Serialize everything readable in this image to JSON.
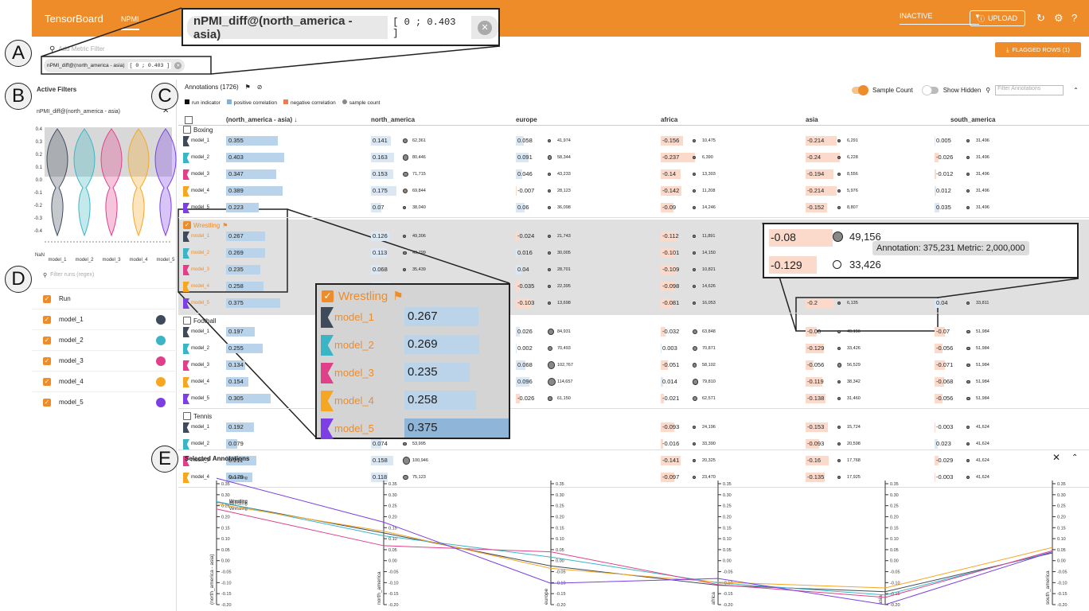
{
  "topbar": {
    "brand": "TensorBoard",
    "tab": "NPMI",
    "mode": "INACTIVE",
    "upload": "UPLOAD"
  },
  "flagged": "FLAGGED ROWS (1)",
  "filter": {
    "placeholder": "Add Metric Filter",
    "chip_metric": "nPMI_diff@(north_america - asia)",
    "chip_range": "[ 0 ; 0.403 ]"
  },
  "left": {
    "active_filters": "Active Filters",
    "filter_name": "nPMI_diff@(north_america - asia)",
    "yticks": [
      "0.4",
      "0.3",
      "0.2",
      "0.1",
      "0.0",
      "-0.1",
      "-0.2",
      "-0.3",
      "-0.4"
    ],
    "nan": "NaN",
    "xlabels": [
      "model_1",
      "model_2",
      "model_3",
      "model_4",
      "model_5"
    ],
    "search_placeholder": "Filter runs (regex)",
    "runs_header": "Run",
    "runs": [
      {
        "name": "model_1",
        "color": "#3f4a5a"
      },
      {
        "name": "model_2",
        "color": "#3bb5c5"
      },
      {
        "name": "model_3",
        "color": "#e0408a"
      },
      {
        "name": "model_4",
        "color": "#f5a623"
      },
      {
        "name": "model_5",
        "color": "#7b3fe4"
      }
    ]
  },
  "annotations": {
    "title": "Annotations (1726)",
    "legend": [
      "run indicator",
      "positive correlation",
      "negative correlation",
      "sample count"
    ],
    "sample_count": "Sample Count",
    "show_hidden": "Show Hidden",
    "filter_placeholder": "Filter Annotations",
    "columns": [
      "(north_america - asia) ↓",
      "north_america",
      "europe",
      "africa",
      "asia",
      "south_america"
    ]
  },
  "groups": [
    {
      "name": "Boxing",
      "rows": [
        {
          "m": "model_1",
          "d": "0.355",
          "v": [
            [
              "0.141",
              "62,361"
            ],
            [
              "0.058",
              "41,974"
            ],
            [
              "-0.156",
              "10,475"
            ],
            [
              "-0.214",
              "6,291"
            ],
            [
              "0.005",
              "31,496"
            ]
          ]
        },
        {
          "m": "model_2",
          "d": "0.403",
          "v": [
            [
              "0.163",
              "80,446"
            ],
            [
              "0.091",
              "58,344"
            ],
            [
              "-0.237",
              "6,390"
            ],
            [
              "-0.24",
              "6,228"
            ],
            [
              "-0.026",
              "31,496"
            ]
          ]
        },
        {
          "m": "model_3",
          "d": "0.347",
          "v": [
            [
              "0.153",
              "71,715"
            ],
            [
              "0.046",
              "43,233"
            ],
            [
              "-0.14",
              "13,303"
            ],
            [
              "-0.194",
              "8,556"
            ],
            [
              "-0.012",
              "31,496"
            ]
          ]
        },
        {
          "m": "model_4",
          "d": "0.389",
          "v": [
            [
              "0.175",
              "69,844"
            ],
            [
              "-0.007",
              "28,123"
            ],
            [
              "-0.142",
              "11,208"
            ],
            [
              "-0.214",
              "5,976"
            ],
            [
              "0.012",
              "31,496"
            ]
          ]
        },
        {
          "m": "model_5",
          "d": "0.223",
          "v": [
            [
              "0.07",
              "38,040"
            ],
            [
              "0.06",
              "36,098"
            ],
            [
              "-0.09",
              "14,246"
            ],
            [
              "-0.152",
              "8,807"
            ],
            [
              "0.035",
              "31,496"
            ]
          ]
        }
      ]
    },
    {
      "name": "Wrestling",
      "rows": [
        {
          "m": "model_1",
          "d": "0.267",
          "v": [
            [
              "0.126",
              "49,306"
            ],
            [
              "-0.024",
              "21,743"
            ],
            [
              "-0.112",
              "11,891"
            ],
            [
              "",
              ""
            ],
            [
              "",
              ""
            ]
          ]
        },
        {
          "m": "model_2",
          "d": "0.269",
          "v": [
            [
              "0.113",
              "49,799"
            ],
            [
              "0.016",
              "30,005"
            ],
            [
              "-0.101",
              "14,150"
            ],
            [
              "",
              ""
            ],
            [
              "",
              ""
            ]
          ]
        },
        {
          "m": "model_3",
          "d": "0.235",
          "v": [
            [
              "0.068",
              "35,439"
            ],
            [
              "0.04",
              "28,701"
            ],
            [
              "-0.109",
              "10,821"
            ],
            [
              "",
              ""
            ],
            [
              "",
              ""
            ]
          ]
        },
        {
          "m": "model_4",
          "d": "0.258",
          "v": [
            [
              "0.134",
              "55,716"
            ],
            [
              "-0.035",
              "22,395"
            ],
            [
              "-0.098",
              "14,626"
            ],
            [
              "",
              ""
            ],
            [
              "",
              ""
            ]
          ]
        },
        {
          "m": "model_5",
          "d": "0.375",
          "v": [
            [
              "0.175",
              "65,084"
            ],
            [
              "-0.103",
              "13,698"
            ],
            [
              "-0.081",
              "16,053"
            ],
            [
              "-0.2",
              "6,135"
            ],
            [
              "0.04",
              "33,811"
            ]
          ]
        }
      ]
    },
    {
      "name": "Football",
      "rows": [
        {
          "m": "model_1",
          "d": "0.197",
          "v": [
            [
              "",
              ""
            ],
            [
              "0.026",
              "84,931"
            ],
            [
              "-0.032",
              "63,848"
            ],
            [
              "-0.08",
              "49,156"
            ],
            [
              "-0.07",
              "51,984"
            ]
          ]
        },
        {
          "m": "model_2",
          "d": "0.255",
          "v": [
            [
              "",
              ""
            ],
            [
              "0.002",
              "70,493"
            ],
            [
              "0.003",
              "70,871"
            ],
            [
              "-0.129",
              "33,426"
            ],
            [
              "-0.056",
              "51,984"
            ]
          ]
        },
        {
          "m": "model_3",
          "d": "0.134",
          "v": [
            [
              "",
              ""
            ],
            [
              "0.068",
              "102,767"
            ],
            [
              "-0.051",
              "58,102"
            ],
            [
              "-0.056",
              "56,529"
            ],
            [
              "-0.071",
              "51,984"
            ]
          ]
        },
        {
          "m": "model_4",
          "d": "0.154",
          "v": [
            [
              "",
              ""
            ],
            [
              "0.096",
              "114,657"
            ],
            [
              "0.014",
              "79,810"
            ],
            [
              "-0.119",
              "38,342"
            ],
            [
              "-0.068",
              "51,984"
            ]
          ]
        },
        {
          "m": "model_5",
          "d": "0.305",
          "v": [
            [
              "",
              ""
            ],
            [
              "-0.026",
              "61,150"
            ],
            [
              "-0.021",
              "62,571"
            ],
            [
              "-0.138",
              "31,460"
            ],
            [
              "-0.056",
              "51,984"
            ]
          ]
        }
      ]
    },
    {
      "name": "Tennis",
      "rows": [
        {
          "m": "model_1",
          "d": "0.192",
          "v": [
            [
              "0.127",
              "78,253"
            ],
            [
              "",
              ""
            ],
            [
              "-0.093",
              "24,196"
            ],
            [
              "-0.153",
              "15,724"
            ],
            [
              "-0.003",
              "41,624"
            ]
          ]
        },
        {
          "m": "model_2",
          "d": "0.079",
          "v": [
            [
              "0.074",
              "53,995"
            ],
            [
              "",
              ""
            ],
            [
              "-0.016",
              "33,390"
            ],
            [
              "-0.093",
              "20,598"
            ],
            [
              "0.023",
              "41,624"
            ]
          ]
        },
        {
          "m": "model_3",
          "d": "0.211",
          "v": [
            [
              "0.158",
              "100,946"
            ],
            [
              "",
              ""
            ],
            [
              "-0.141",
              "20,325"
            ],
            [
              "-0.16",
              "17,768"
            ],
            [
              "-0.029",
              "41,624"
            ]
          ]
        },
        {
          "m": "model_4",
          "d": "0.179",
          "v": [
            [
              "0.118",
              "75,123"
            ],
            [
              "",
              ""
            ],
            [
              "-0.097",
              "23,470"
            ],
            [
              "-0.135",
              "17,925"
            ],
            [
              "-0.003",
              "41,624"
            ]
          ]
        }
      ]
    }
  ],
  "zoom_wrestling": {
    "title": "Wrestling",
    "rows": [
      [
        "model_1",
        "0.267"
      ],
      [
        "model_2",
        "0.269"
      ],
      [
        "model_3",
        "0.235"
      ],
      [
        "model_4",
        "0.258"
      ],
      [
        "model_5",
        "0.375"
      ]
    ]
  },
  "zoom_football": {
    "rows": [
      [
        "-0.08",
        "49,156"
      ],
      [
        "-0.129",
        "33,426"
      ]
    ],
    "tooltip": "Annotation: 375,231 Metric: 2,000,000"
  },
  "selected": {
    "title": "Selected Annotations",
    "axes": [
      "(north_america - asia)",
      "north_america",
      "europe",
      "africa",
      "asia",
      "south_america"
    ],
    "ticks": [
      "0.35",
      "0.30",
      "0.25",
      "0.20",
      "0.15",
      "0.10",
      "0.05",
      "0.00",
      "-0.05",
      "-0.10",
      "-0.15",
      "-0.20"
    ],
    "line_label": "Wrestling"
  },
  "callouts": [
    "A",
    "B",
    "C",
    "D",
    "E"
  ],
  "chart_data": {
    "type": "line",
    "title": "Selected Annotations",
    "x": [
      "(north_america - asia)",
      "north_america",
      "europe",
      "africa",
      "asia",
      "south_america"
    ],
    "ylim": [
      -0.2,
      0.35
    ],
    "series": [
      {
        "name": "model_1",
        "values": [
          0.267,
          0.126,
          -0.024,
          -0.112,
          -0.141,
          0.035
        ]
      },
      {
        "name": "model_2",
        "values": [
          0.269,
          0.113,
          0.016,
          -0.101,
          -0.156,
          0.04
        ]
      },
      {
        "name": "model_3",
        "values": [
          0.235,
          0.068,
          0.04,
          -0.109,
          -0.167,
          0.045
        ]
      },
      {
        "name": "model_4",
        "values": [
          0.258,
          0.134,
          -0.035,
          -0.098,
          -0.124,
          0.06
        ]
      },
      {
        "name": "model_5",
        "values": [
          0.375,
          0.175,
          -0.103,
          -0.081,
          -0.2,
          0.04
        ]
      }
    ]
  }
}
